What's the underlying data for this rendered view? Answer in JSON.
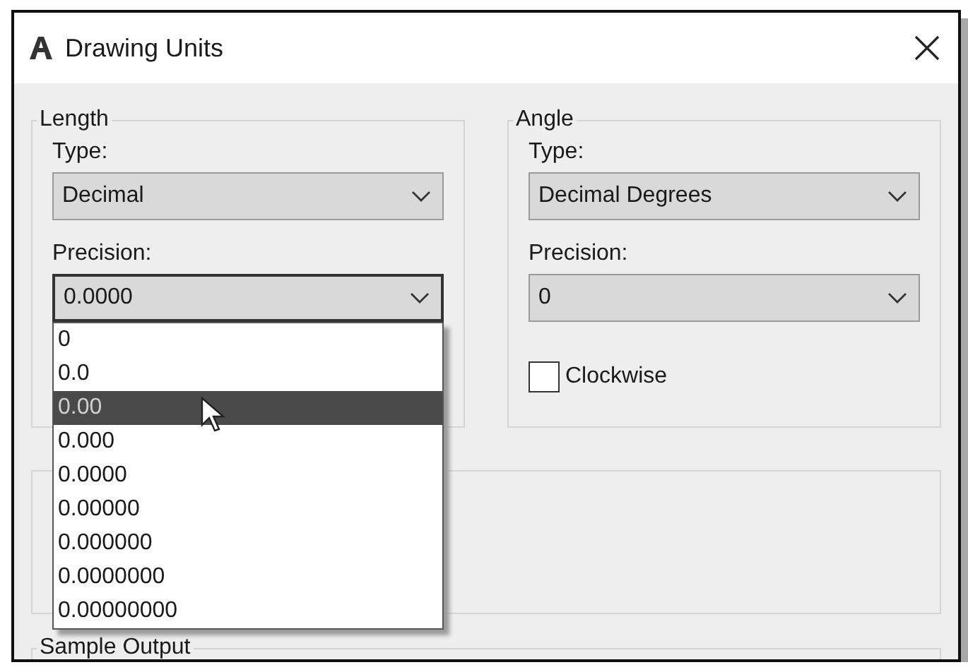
{
  "window": {
    "title": "Drawing Units"
  },
  "length": {
    "legend": "Length",
    "type_label": "Type:",
    "type_value": "Decimal",
    "precision_label": "Precision:",
    "precision_value": "0.0000",
    "precision_expanded": true,
    "precision_options": [
      {
        "label": "0",
        "selected": false
      },
      {
        "label": "0.0",
        "selected": false
      },
      {
        "label": "0.00",
        "selected": true
      },
      {
        "label": "0.000",
        "selected": false
      },
      {
        "label": "0.0000",
        "selected": false
      },
      {
        "label": "0.00000",
        "selected": false
      },
      {
        "label": "0.000000",
        "selected": false
      },
      {
        "label": "0.0000000",
        "selected": false
      },
      {
        "label": "0.00000000",
        "selected": false
      }
    ]
  },
  "angle": {
    "legend": "Angle",
    "type_label": "Type:",
    "type_value": "Decimal Degrees",
    "precision_label": "Precision:",
    "precision_value": "0",
    "clockwise": {
      "label": "Clockwise",
      "checked": false
    }
  },
  "sample_output": {
    "legend": "Sample Output"
  }
}
